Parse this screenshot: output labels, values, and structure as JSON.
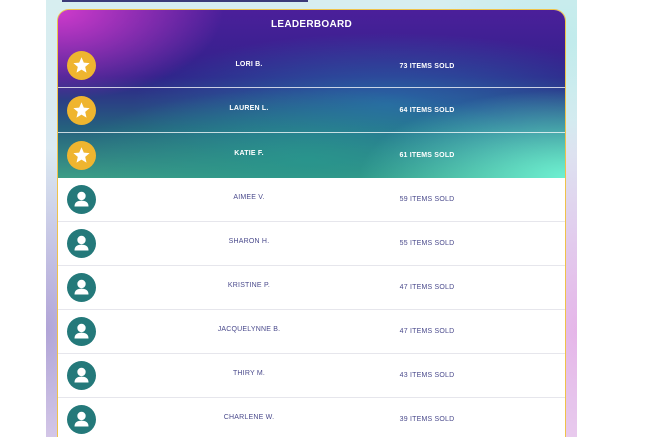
{
  "leaderboard": {
    "title": "LEADERBOARD",
    "top_entries": [
      {
        "name": "LORI B.",
        "sold": "73 ITEMS SOLD",
        "icon": "star-icon"
      },
      {
        "name": "LAUREN L.",
        "sold": "64 ITEMS SOLD",
        "icon": "star-icon"
      },
      {
        "name": "KATIE F.",
        "sold": "61 ITEMS SOLD",
        "icon": "star-icon"
      }
    ],
    "entries": [
      {
        "name": "AIMEE V.",
        "sold": "59 ITEMS SOLD",
        "icon": "user-icon"
      },
      {
        "name": "SHARON H.",
        "sold": "55 ITEMS SOLD",
        "icon": "user-icon"
      },
      {
        "name": "KRISTINE P.",
        "sold": "47 ITEMS SOLD",
        "icon": "user-icon"
      },
      {
        "name": "JACQUELYNNE B.",
        "sold": "47 ITEMS SOLD",
        "icon": "user-icon"
      },
      {
        "name": "THIRY M.",
        "sold": "43 ITEMS SOLD",
        "icon": "user-icon"
      },
      {
        "name": "CHARLENE W.",
        "sold": "39 ITEMS SOLD",
        "icon": "user-icon"
      }
    ],
    "colors": {
      "border": "#efc24a",
      "star_badge": "#efb52f",
      "user_badge": "#24797a",
      "text": "#4a4a8c"
    }
  }
}
